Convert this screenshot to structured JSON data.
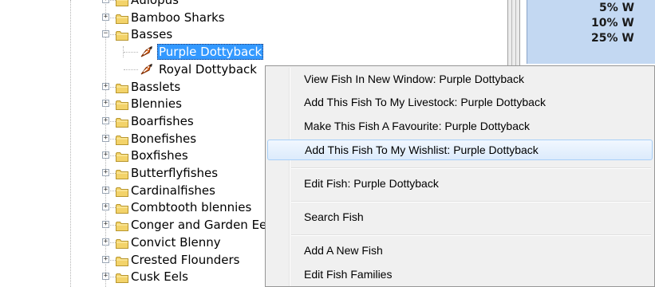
{
  "tree": {
    "items": [
      {
        "label": "Aulopus",
        "type": "folder",
        "expander": "+"
      },
      {
        "label": "Bamboo Sharks",
        "type": "folder",
        "expander": "+"
      },
      {
        "label": "Basses",
        "type": "folder",
        "expander": "−"
      },
      {
        "label": "Purple Dottyback",
        "type": "fish",
        "selected": true
      },
      {
        "label": "Royal Dottyback",
        "type": "fish"
      },
      {
        "label": "Basslets",
        "type": "folder",
        "expander": "+"
      },
      {
        "label": "Blennies",
        "type": "folder",
        "expander": "+"
      },
      {
        "label": "Boarfishes",
        "type": "folder",
        "expander": "+"
      },
      {
        "label": "Bonefishes",
        "type": "folder",
        "expander": "+"
      },
      {
        "label": "Boxfishes",
        "type": "folder",
        "expander": "+"
      },
      {
        "label": "Butterflyfishes",
        "type": "folder",
        "expander": "+"
      },
      {
        "label": "Cardinalfishes",
        "type": "folder",
        "expander": "+"
      },
      {
        "label": "Combtooth blennies",
        "type": "folder",
        "expander": "+"
      },
      {
        "label": "Conger and Garden Eels",
        "type": "folder",
        "expander": "+"
      },
      {
        "label": "Convict Blenny",
        "type": "folder",
        "expander": "+"
      },
      {
        "label": "Crested Flounders",
        "type": "folder",
        "expander": "+"
      },
      {
        "label": "Cusk Eels",
        "type": "folder",
        "expander": "+"
      }
    ]
  },
  "right_panel": {
    "rows": [
      "5% W",
      "10% W",
      "25% W"
    ]
  },
  "context_menu": {
    "items": [
      {
        "label": "View Fish In New Window: Purple Dottyback"
      },
      {
        "label": "Add This Fish To My Livestock: Purple Dottyback"
      },
      {
        "label": "Make This Fish A Favourite: Purple Dottyback"
      },
      {
        "label": "Add This Fish To My Wishlist: Purple Dottyback",
        "highlighted": true
      },
      {
        "label": "Edit Fish: Purple Dottyback"
      },
      {
        "label": "Search Fish"
      },
      {
        "label": "Add A New Fish"
      },
      {
        "label": "Edit Fish Families"
      }
    ]
  },
  "colors": {
    "selection": "#3399ff",
    "menu_background": "#f0f0f0",
    "menu_highlight": "#dcebfc",
    "right_panel_background": "#c3d8f2",
    "folder": "#f3d36a",
    "fish": "#e0661c"
  },
  "icons": {
    "folder": "folder-icon",
    "fish": "fish-icon",
    "expand": "expand-plus-icon",
    "collapse": "collapse-minus-icon"
  }
}
